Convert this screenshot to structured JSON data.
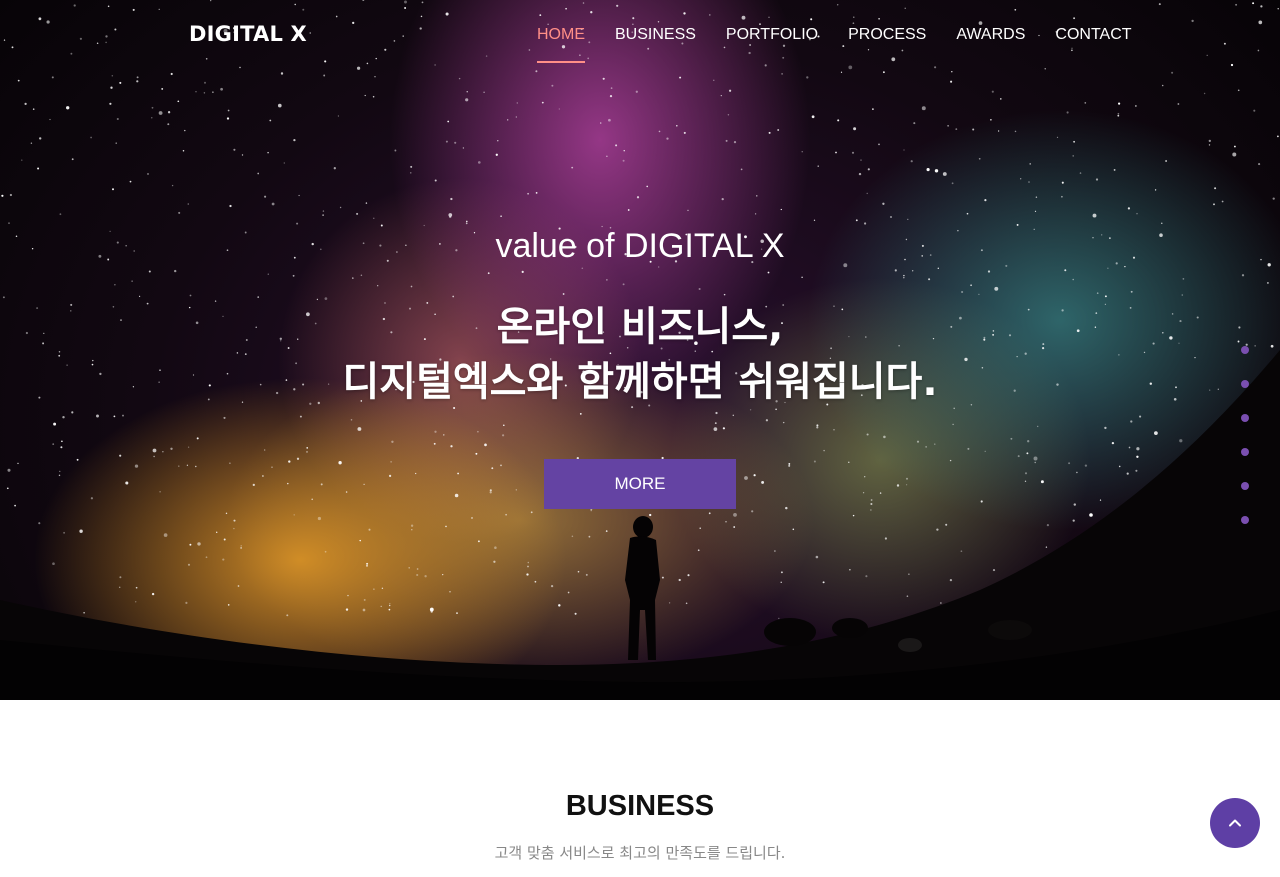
{
  "header": {
    "logo": "DIGITAL X",
    "nav": [
      {
        "label": "HOME",
        "active": true
      },
      {
        "label": "BUSINESS",
        "active": false
      },
      {
        "label": "PORTFOLIO",
        "active": false
      },
      {
        "label": "PROCESS",
        "active": false
      },
      {
        "label": "AWARDS",
        "active": false
      },
      {
        "label": "CONTACT",
        "active": false
      }
    ]
  },
  "hero": {
    "subtitle": "value of DIGITAL X",
    "title_line1": "온라인 비즈니스,",
    "title_line2": "디지털엑스와 함께하면 쉬워집니다.",
    "button": "MORE"
  },
  "side_dots": {
    "count": 6
  },
  "business": {
    "title": "BUSINESS",
    "subtitle": "고객 맞춤 서비스로 최고의 만족도를 드립니다."
  },
  "scroll_top": {
    "icon": "chevron-up-icon"
  },
  "colors": {
    "accent": "#6443a3",
    "nav_active": "#ff8f87",
    "scroll_top_bg": "#5e3fa5"
  }
}
